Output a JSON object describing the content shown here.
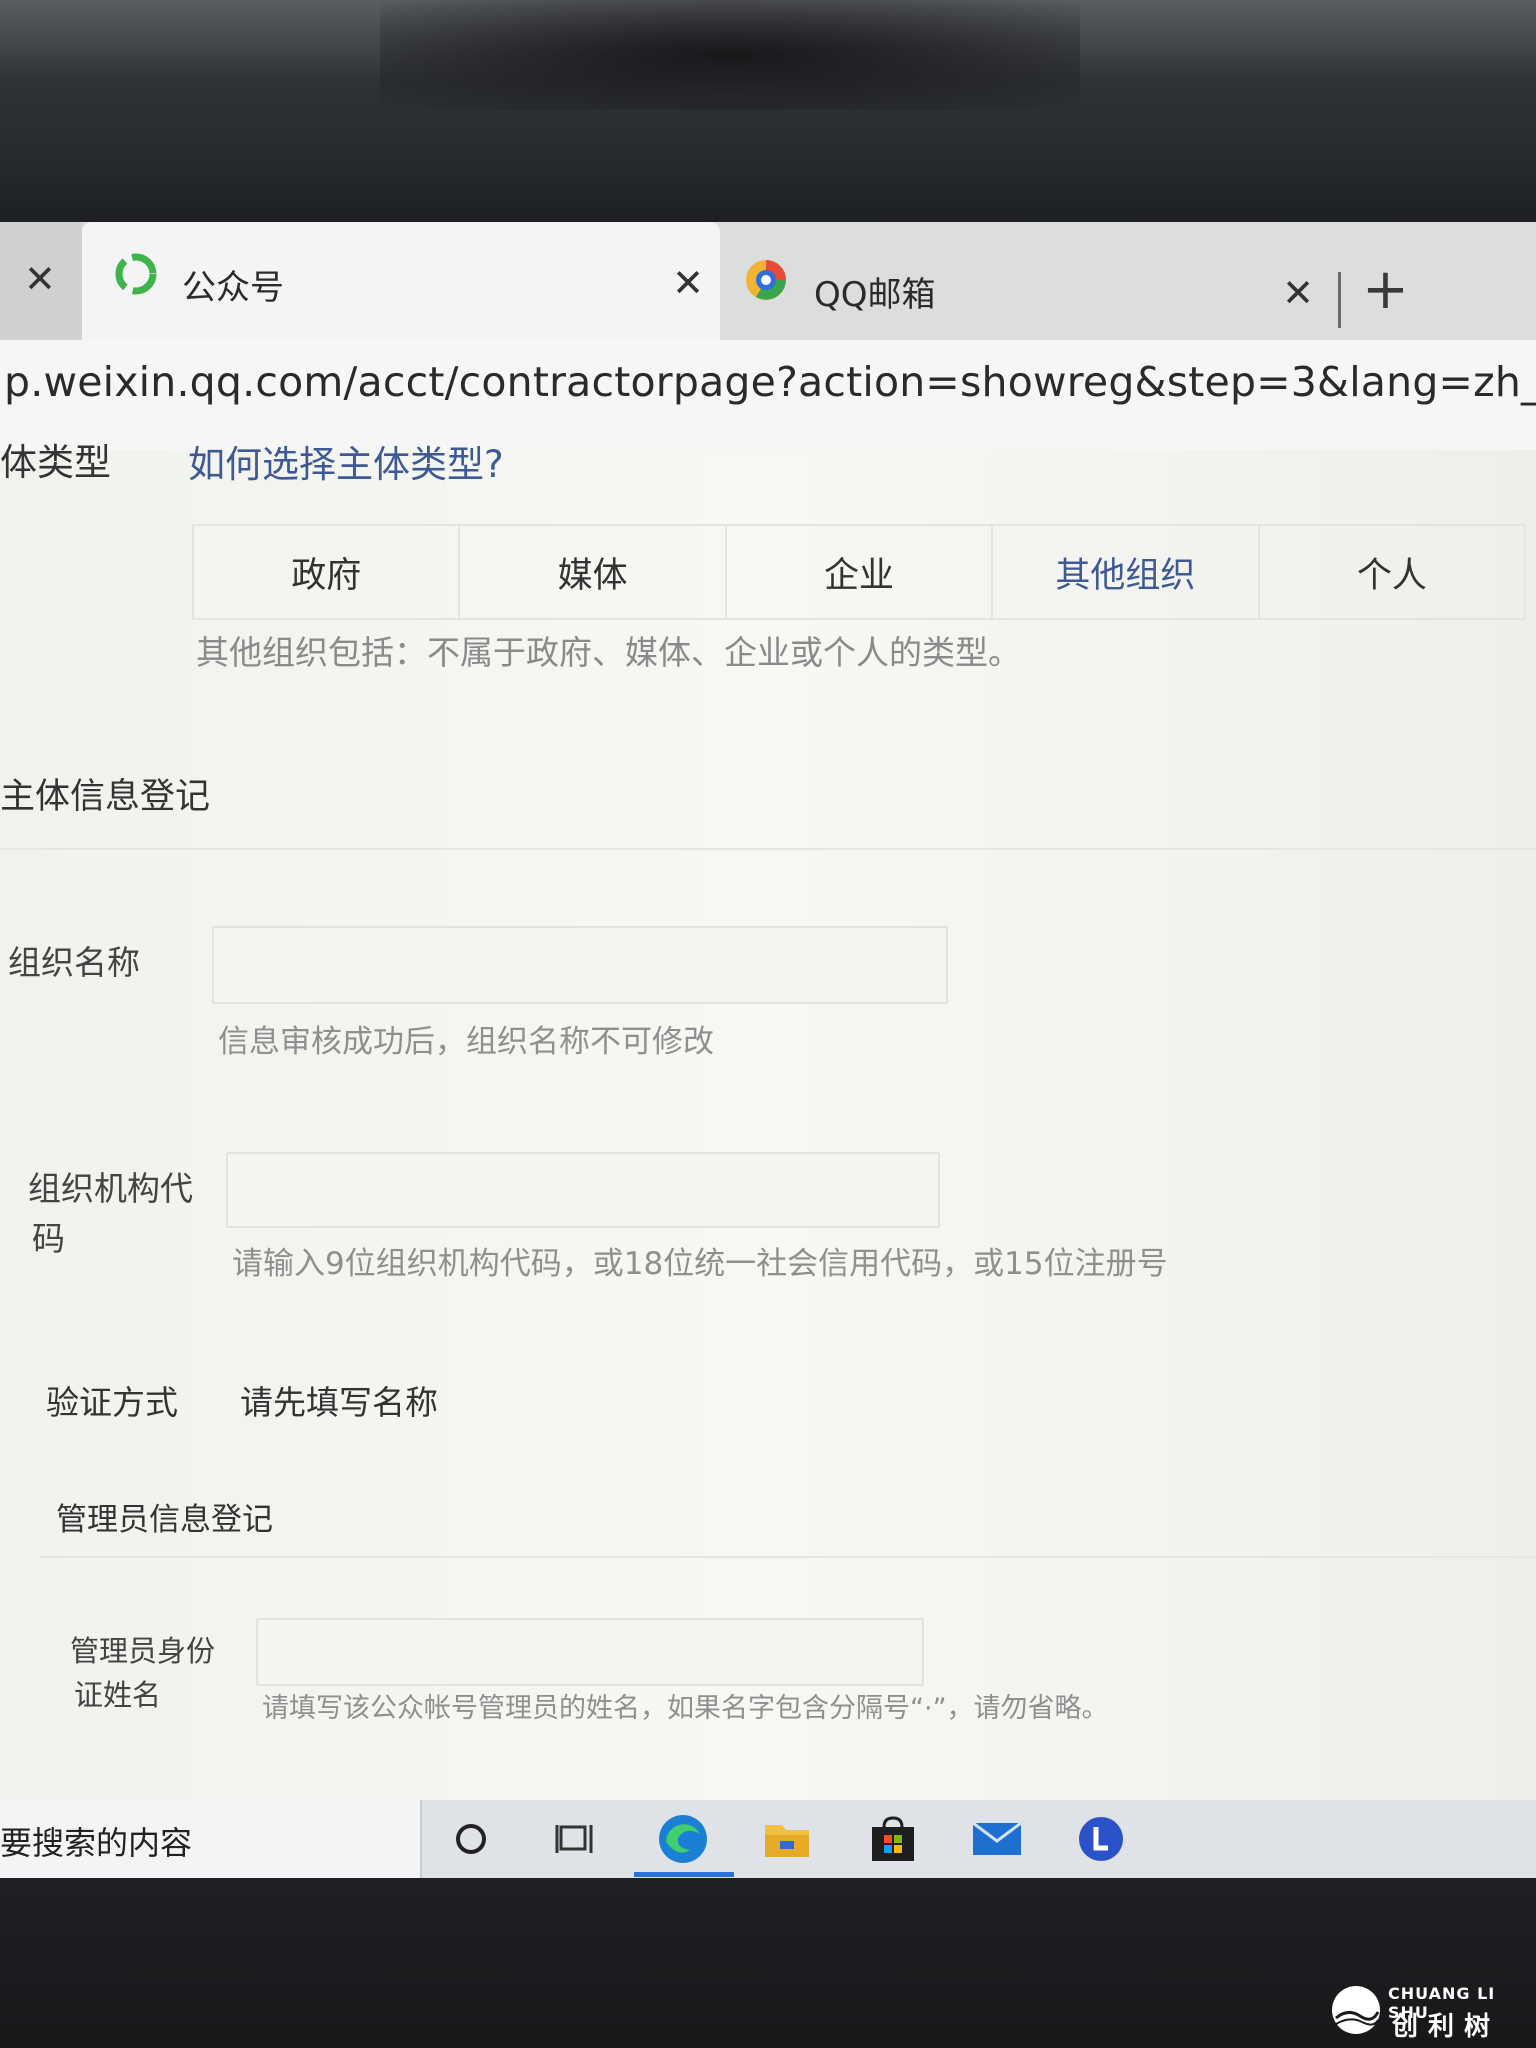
{
  "tabs": [
    {
      "title": "公众号",
      "favicon": "weixin-mp-icon"
    },
    {
      "title": "QQ邮箱",
      "favicon": "qq-mail-icon"
    }
  ],
  "address": {
    "url": "p.weixin.qq.com/acct/contractorpage?action=showreg&step=3&lang=zh_CN"
  },
  "subject_type": {
    "label": "体类型",
    "help_link": "如何选择主体类型?",
    "options": [
      "政府",
      "媒体",
      "企业",
      "其他组织",
      "个人"
    ],
    "selected": "其他组织",
    "description": "其他组织包括：不属于政府、媒体、企业或个人的类型。"
  },
  "subject_info": {
    "heading": "主体信息登记",
    "org_name_label": "组织名称",
    "org_name_value": "",
    "org_name_hint": "信息审核成功后，组织名称不可修改",
    "org_code_label_1": "组织机构代",
    "org_code_label_2": "码",
    "org_code_value": "",
    "org_code_hint": "请输入9位组织机构代码，或18位统一社会信用代码，或15位注册号",
    "verify_label": "验证方式",
    "verify_value": "请先填写名称"
  },
  "admin_info": {
    "heading": "管理员信息登记",
    "name_label_1": "管理员身份",
    "name_label_2": "证姓名",
    "name_value": "",
    "name_hint": "请填写该公众帐号管理员的姓名，如果名字包含分隔号“·”，请勿省略。"
  },
  "taskbar": {
    "search_text": "要搜索的内容",
    "icons": [
      "cortana-icon",
      "task-view-icon",
      "edge-icon",
      "file-explorer-icon",
      "store-icon",
      "mail-icon",
      "app-l-icon"
    ]
  },
  "watermark": {
    "en": "CHUANG LI SHU",
    "cn": "创利树"
  }
}
